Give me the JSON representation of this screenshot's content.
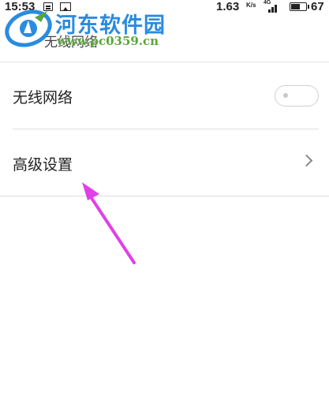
{
  "status_bar": {
    "time": "15:53",
    "network_speed": "1.63",
    "network_speed_unit": "K/s",
    "network_type": "4G",
    "battery_level": "67"
  },
  "header": {
    "title": "无线网络"
  },
  "watermark": {
    "site_name": "河东软件园",
    "url": "www.pc0359.cn"
  },
  "settings": {
    "wifi_label": "无线网络",
    "wifi_enabled": false,
    "advanced_label": "高级设置"
  },
  "colors": {
    "annotation_arrow": "#e040e8",
    "watermark_blue": "#2a8be0",
    "watermark_green": "#5aa63a"
  }
}
